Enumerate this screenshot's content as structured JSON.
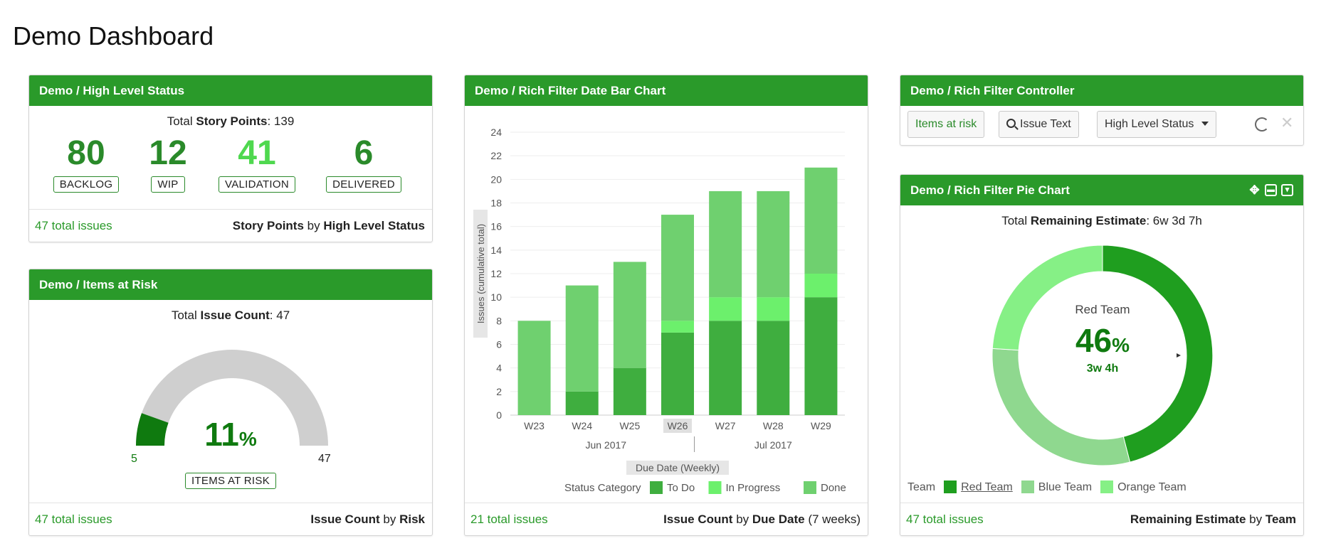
{
  "page_title": "Demo Dashboard",
  "colors": {
    "header": "#2a9a2a",
    "todo": "#3fae3f",
    "in_progress": "#6cf06c",
    "done": "#6fd06f",
    "accent": "#2a8a2a"
  },
  "high_level_status": {
    "title": "Demo / High Level Status",
    "total_label": "Total",
    "total_bold": "Story Points",
    "total_value": ": 139",
    "kpis": [
      {
        "value": "80",
        "label": "BACKLOG"
      },
      {
        "value": "12",
        "label": "WIP"
      },
      {
        "value": "41",
        "label": "VALIDATION"
      },
      {
        "value": "6",
        "label": "DELIVERED"
      }
    ],
    "footer_left": "47 total issues",
    "footer_right_a": "Story Points",
    "footer_right_by": "by",
    "footer_right_b": "High Level Status"
  },
  "items_at_risk": {
    "title": "Demo / Items at Risk",
    "total_label": "Total",
    "total_bold": "Issue Count",
    "total_value": ": 47",
    "gauge_value": "11",
    "gauge_pct": "%",
    "gauge_min": "5",
    "gauge_max": "47",
    "gauge_fraction": 0.11,
    "badge": "ITEMS AT RISK",
    "footer_left": "47 total issues",
    "footer_right_a": "Issue Count",
    "footer_right_by": "by",
    "footer_right_b": "Risk"
  },
  "bar_chart_widget": {
    "title": "Demo / Rich Filter Date Bar Chart",
    "footer_left": "21 total issues",
    "footer_right_a": "Issue Count",
    "footer_right_by": "by",
    "footer_right_b": "Due Date",
    "footer_right_c": "(7 weeks)"
  },
  "chart_data": {
    "type": "bar",
    "stacked": true,
    "categories": [
      "W23",
      "W24",
      "W25",
      "W26",
      "W27",
      "W28",
      "W29"
    ],
    "month_labels": [
      "Jun 2017",
      "Jul 2017"
    ],
    "series": [
      {
        "name": "To Do",
        "values": [
          0,
          2,
          4,
          7,
          8,
          8,
          10
        ]
      },
      {
        "name": "In Progress",
        "values": [
          0,
          0,
          0,
          1,
          2,
          2,
          2
        ]
      },
      {
        "name": "Done",
        "values": [
          8,
          9,
          9,
          9,
          9,
          9,
          9
        ]
      }
    ],
    "ylim": [
      0,
      24
    ],
    "yticks": [
      "0",
      "2",
      "4",
      "6",
      "8",
      "10",
      "12",
      "14",
      "16",
      "18",
      "20",
      "22",
      "24"
    ],
    "ylabel": "Issues (cumulative total)",
    "xlabel": "Due Date (Weekly)",
    "legend_title": "Status Category",
    "legend_position": "bottom-right",
    "grid": true
  },
  "controller": {
    "title": "Demo / Rich Filter Controller",
    "btn_items": "Items at risk",
    "btn_search": "Issue Text",
    "btn_status": "High Level Status"
  },
  "pie_widget": {
    "title": "Demo / Rich Filter Pie Chart",
    "total_label": "Total",
    "total_bold": "Remaining Estimate",
    "total_value": ": 6w 3d 7h",
    "center_team": "Red Team",
    "center_pct": "46",
    "center_pct_sign": "%",
    "center_time": "3w 4h",
    "legend_title": "Team",
    "slices": [
      {
        "name": "Red Team",
        "fraction": 0.46,
        "color": "#1f9e1f"
      },
      {
        "name": "Blue Team",
        "fraction": 0.3,
        "color": "#8fd88f"
      },
      {
        "name": "Orange Team",
        "fraction": 0.24,
        "color": "#86f086"
      }
    ],
    "footer_left": "47 total issues",
    "footer_right_a": "Remaining Estimate",
    "footer_right_by": "by",
    "footer_right_b": "Team"
  }
}
